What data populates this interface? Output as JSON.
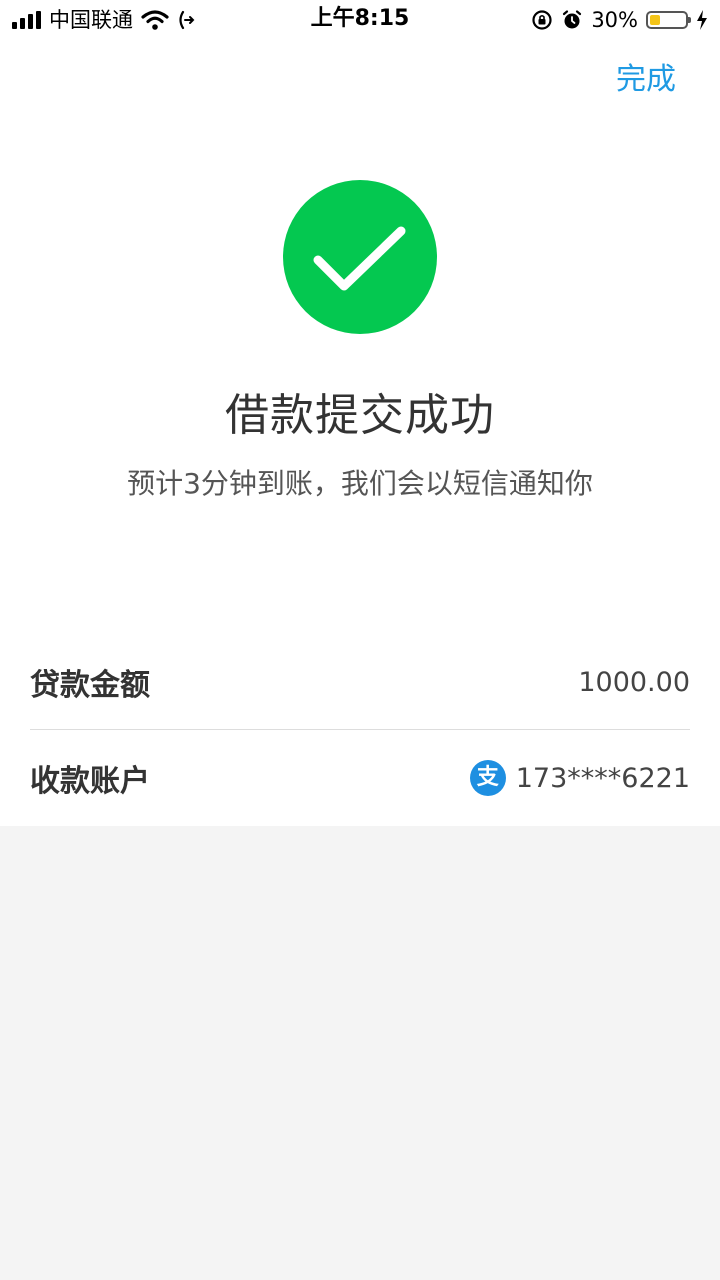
{
  "status_bar": {
    "carrier": "中国联通",
    "time": "上午8:15",
    "battery_percent": "30%",
    "battery_level": 0.3,
    "icons": [
      "signal-icon",
      "wifi-icon",
      "call-forward-icon",
      "rotation-lock-icon",
      "alarm-icon",
      "battery-icon",
      "charging-icon"
    ]
  },
  "header": {
    "done_label": "完成"
  },
  "result": {
    "title": "借款提交成功",
    "subtitle": "预计3分钟到账，我们会以短信通知你",
    "icon": "checkmark-circle-icon",
    "accent_color": "#04c850"
  },
  "details": {
    "amount_label": "贷款金额",
    "amount_value": "1000.00",
    "account_label": "收款账户",
    "account_icon_glyph": "支",
    "account_value": "173****6221"
  },
  "colors": {
    "link": "#1f9ae3",
    "alipay": "#1e8fe1"
  }
}
